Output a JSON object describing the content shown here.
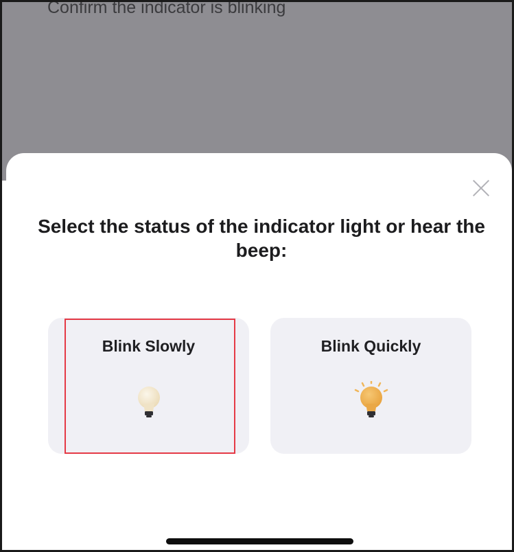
{
  "background_screen": {
    "text": "Confirm the indicator is blinking"
  },
  "sheet": {
    "title": "Select the status of the indicator light or hear the beep:",
    "close_icon": "close-icon",
    "options": [
      {
        "label": "Blink Slowly",
        "icon": "dim-bulb-icon",
        "highlighted": true
      },
      {
        "label": "Blink Quickly",
        "icon": "glowing-bulb-icon",
        "highlighted": false
      }
    ]
  },
  "colors": {
    "backdrop": "#8e8d92",
    "card": "#f0f0f5",
    "highlight": "#e53945",
    "bulb_dim": "#f3e7cf",
    "bulb_bright": "#efb154"
  }
}
